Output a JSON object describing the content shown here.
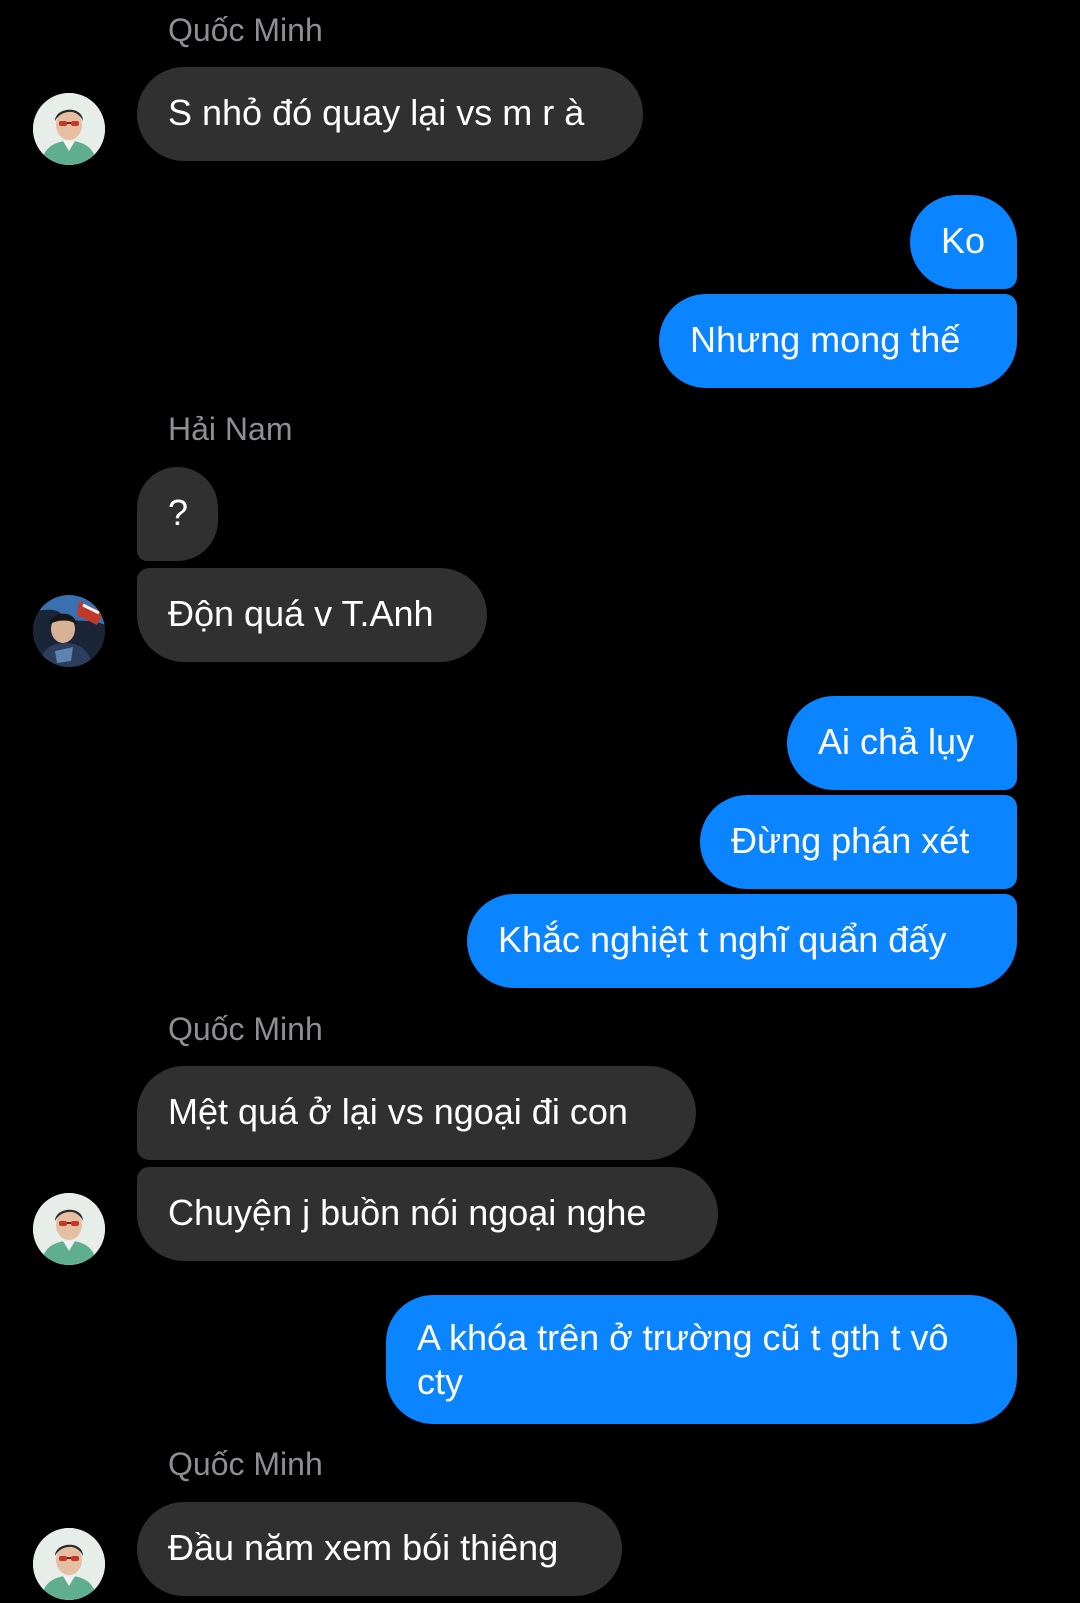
{
  "conversation": {
    "senders": {
      "quoc_minh": "Quốc Minh",
      "hai_nam": "Hải Nam"
    },
    "messages": [
      {
        "from": "Quốc Minh",
        "text": "S nhỏ đó quay lại vs m r à"
      },
      {
        "from": "me",
        "text": "Ko"
      },
      {
        "from": "me",
        "text": "Nhưng mong thế"
      },
      {
        "from": "Hải Nam",
        "text": "?"
      },
      {
        "from": "Hải Nam",
        "text": "Độn quá v T.Anh"
      },
      {
        "from": "me",
        "text": "Ai chả lụy"
      },
      {
        "from": "me",
        "text": "Đừng phán xét"
      },
      {
        "from": "me",
        "text": "Khắc nghiệt t nghĩ quẩn đấy"
      },
      {
        "from": "Quốc Minh",
        "text": "Mệt quá ở lại vs ngoại đi con"
      },
      {
        "from": "Quốc Minh",
        "text": "Chuyện j buồn nói ngoại nghe"
      },
      {
        "from": "me",
        "text": "A khóa trên ở trường cũ t gth t vô cty"
      },
      {
        "from": "Quốc Minh",
        "text": "Đầu năm xem bói thiêng"
      }
    ]
  },
  "colors": {
    "background": "#000000",
    "incoming_bubble": "#303030",
    "outgoing_bubble": "#0a84ff",
    "sender_name": "#8e8e93",
    "text": "#ffffff"
  },
  "icons": {
    "avatar_quoc_minh": "avatar-photo",
    "avatar_hai_nam": "avatar-photo"
  }
}
